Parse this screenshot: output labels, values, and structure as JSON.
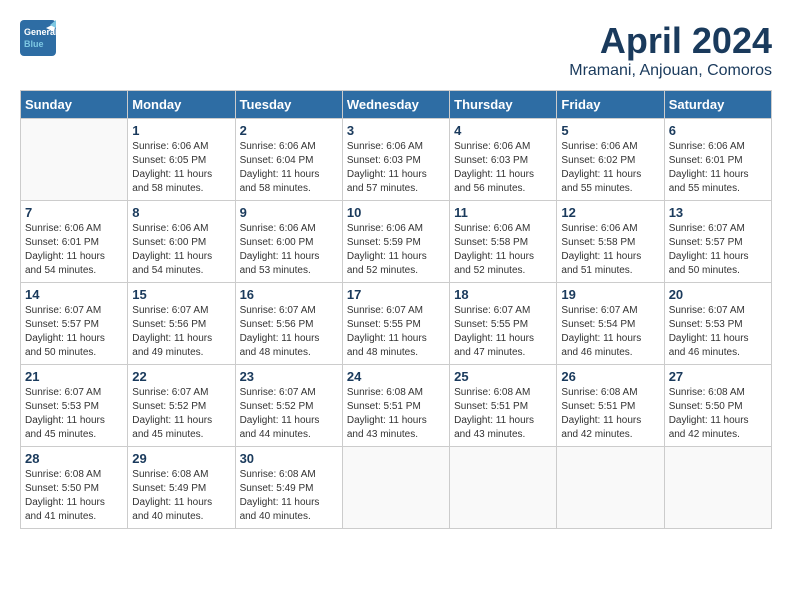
{
  "header": {
    "logo_general": "General",
    "logo_blue": "Blue",
    "month": "April 2024",
    "location": "Mramani, Anjouan, Comoros"
  },
  "weekdays": [
    "Sunday",
    "Monday",
    "Tuesday",
    "Wednesday",
    "Thursday",
    "Friday",
    "Saturday"
  ],
  "weeks": [
    [
      {
        "day": "",
        "sunrise": "",
        "sunset": "",
        "daylight": ""
      },
      {
        "day": "1",
        "sunrise": "Sunrise: 6:06 AM",
        "sunset": "Sunset: 6:05 PM",
        "daylight": "Daylight: 11 hours and 58 minutes."
      },
      {
        "day": "2",
        "sunrise": "Sunrise: 6:06 AM",
        "sunset": "Sunset: 6:04 PM",
        "daylight": "Daylight: 11 hours and 58 minutes."
      },
      {
        "day": "3",
        "sunrise": "Sunrise: 6:06 AM",
        "sunset": "Sunset: 6:03 PM",
        "daylight": "Daylight: 11 hours and 57 minutes."
      },
      {
        "day": "4",
        "sunrise": "Sunrise: 6:06 AM",
        "sunset": "Sunset: 6:03 PM",
        "daylight": "Daylight: 11 hours and 56 minutes."
      },
      {
        "day": "5",
        "sunrise": "Sunrise: 6:06 AM",
        "sunset": "Sunset: 6:02 PM",
        "daylight": "Daylight: 11 hours and 55 minutes."
      },
      {
        "day": "6",
        "sunrise": "Sunrise: 6:06 AM",
        "sunset": "Sunset: 6:01 PM",
        "daylight": "Daylight: 11 hours and 55 minutes."
      }
    ],
    [
      {
        "day": "7",
        "sunrise": "Sunrise: 6:06 AM",
        "sunset": "Sunset: 6:01 PM",
        "daylight": "Daylight: 11 hours and 54 minutes."
      },
      {
        "day": "8",
        "sunrise": "Sunrise: 6:06 AM",
        "sunset": "Sunset: 6:00 PM",
        "daylight": "Daylight: 11 hours and 54 minutes."
      },
      {
        "day": "9",
        "sunrise": "Sunrise: 6:06 AM",
        "sunset": "Sunset: 6:00 PM",
        "daylight": "Daylight: 11 hours and 53 minutes."
      },
      {
        "day": "10",
        "sunrise": "Sunrise: 6:06 AM",
        "sunset": "Sunset: 5:59 PM",
        "daylight": "Daylight: 11 hours and 52 minutes."
      },
      {
        "day": "11",
        "sunrise": "Sunrise: 6:06 AM",
        "sunset": "Sunset: 5:58 PM",
        "daylight": "Daylight: 11 hours and 52 minutes."
      },
      {
        "day": "12",
        "sunrise": "Sunrise: 6:06 AM",
        "sunset": "Sunset: 5:58 PM",
        "daylight": "Daylight: 11 hours and 51 minutes."
      },
      {
        "day": "13",
        "sunrise": "Sunrise: 6:07 AM",
        "sunset": "Sunset: 5:57 PM",
        "daylight": "Daylight: 11 hours and 50 minutes."
      }
    ],
    [
      {
        "day": "14",
        "sunrise": "Sunrise: 6:07 AM",
        "sunset": "Sunset: 5:57 PM",
        "daylight": "Daylight: 11 hours and 50 minutes."
      },
      {
        "day": "15",
        "sunrise": "Sunrise: 6:07 AM",
        "sunset": "Sunset: 5:56 PM",
        "daylight": "Daylight: 11 hours and 49 minutes."
      },
      {
        "day": "16",
        "sunrise": "Sunrise: 6:07 AM",
        "sunset": "Sunset: 5:56 PM",
        "daylight": "Daylight: 11 hours and 48 minutes."
      },
      {
        "day": "17",
        "sunrise": "Sunrise: 6:07 AM",
        "sunset": "Sunset: 5:55 PM",
        "daylight": "Daylight: 11 hours and 48 minutes."
      },
      {
        "day": "18",
        "sunrise": "Sunrise: 6:07 AM",
        "sunset": "Sunset: 5:55 PM",
        "daylight": "Daylight: 11 hours and 47 minutes."
      },
      {
        "day": "19",
        "sunrise": "Sunrise: 6:07 AM",
        "sunset": "Sunset: 5:54 PM",
        "daylight": "Daylight: 11 hours and 46 minutes."
      },
      {
        "day": "20",
        "sunrise": "Sunrise: 6:07 AM",
        "sunset": "Sunset: 5:53 PM",
        "daylight": "Daylight: 11 hours and 46 minutes."
      }
    ],
    [
      {
        "day": "21",
        "sunrise": "Sunrise: 6:07 AM",
        "sunset": "Sunset: 5:53 PM",
        "daylight": "Daylight: 11 hours and 45 minutes."
      },
      {
        "day": "22",
        "sunrise": "Sunrise: 6:07 AM",
        "sunset": "Sunset: 5:52 PM",
        "daylight": "Daylight: 11 hours and 45 minutes."
      },
      {
        "day": "23",
        "sunrise": "Sunrise: 6:07 AM",
        "sunset": "Sunset: 5:52 PM",
        "daylight": "Daylight: 11 hours and 44 minutes."
      },
      {
        "day": "24",
        "sunrise": "Sunrise: 6:08 AM",
        "sunset": "Sunset: 5:51 PM",
        "daylight": "Daylight: 11 hours and 43 minutes."
      },
      {
        "day": "25",
        "sunrise": "Sunrise: 6:08 AM",
        "sunset": "Sunset: 5:51 PM",
        "daylight": "Daylight: 11 hours and 43 minutes."
      },
      {
        "day": "26",
        "sunrise": "Sunrise: 6:08 AM",
        "sunset": "Sunset: 5:51 PM",
        "daylight": "Daylight: 11 hours and 42 minutes."
      },
      {
        "day": "27",
        "sunrise": "Sunrise: 6:08 AM",
        "sunset": "Sunset: 5:50 PM",
        "daylight": "Daylight: 11 hours and 42 minutes."
      }
    ],
    [
      {
        "day": "28",
        "sunrise": "Sunrise: 6:08 AM",
        "sunset": "Sunset: 5:50 PM",
        "daylight": "Daylight: 11 hours and 41 minutes."
      },
      {
        "day": "29",
        "sunrise": "Sunrise: 6:08 AM",
        "sunset": "Sunset: 5:49 PM",
        "daylight": "Daylight: 11 hours and 40 minutes."
      },
      {
        "day": "30",
        "sunrise": "Sunrise: 6:08 AM",
        "sunset": "Sunset: 5:49 PM",
        "daylight": "Daylight: 11 hours and 40 minutes."
      },
      {
        "day": "",
        "sunrise": "",
        "sunset": "",
        "daylight": ""
      },
      {
        "day": "",
        "sunrise": "",
        "sunset": "",
        "daylight": ""
      },
      {
        "day": "",
        "sunrise": "",
        "sunset": "",
        "daylight": ""
      },
      {
        "day": "",
        "sunrise": "",
        "sunset": "",
        "daylight": ""
      }
    ]
  ]
}
